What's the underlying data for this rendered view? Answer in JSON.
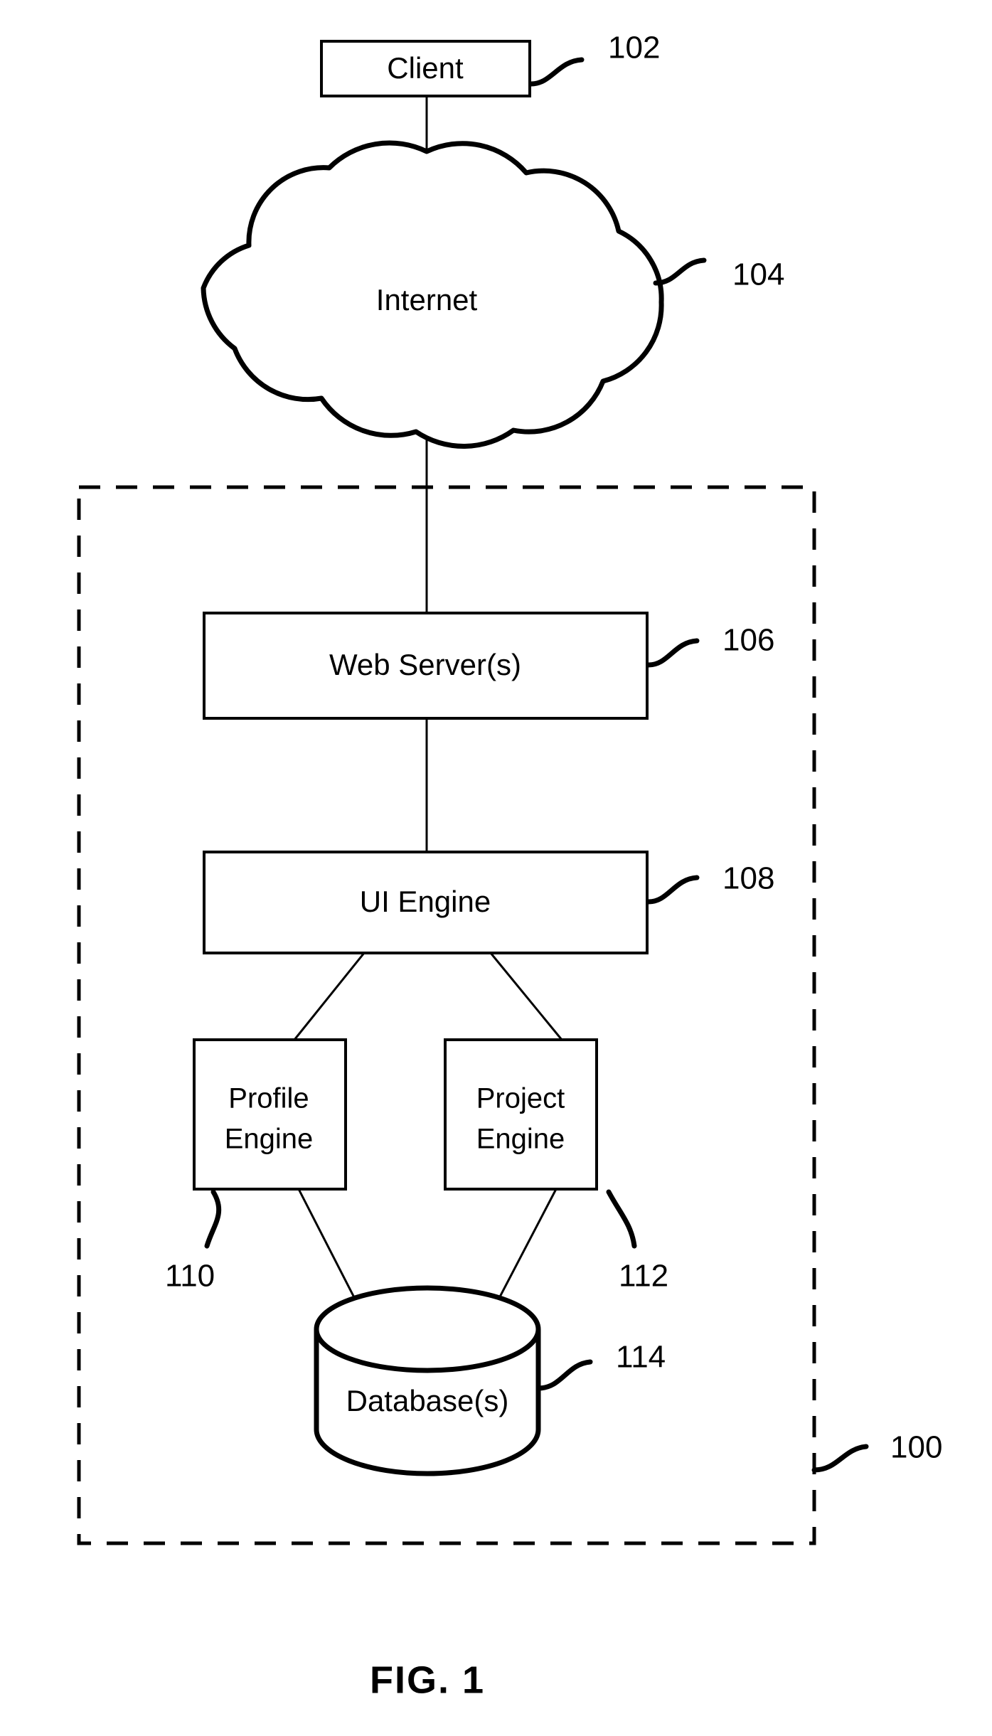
{
  "figure": {
    "caption": "FIG. 1",
    "system_ref": "100"
  },
  "nodes": {
    "client": {
      "label": "Client",
      "ref": "102"
    },
    "internet": {
      "label": "Internet",
      "ref": "104"
    },
    "web_server": {
      "label": "Web Server(s)",
      "ref": "106"
    },
    "ui_engine": {
      "label": "UI Engine",
      "ref": "108"
    },
    "profile_engine": {
      "label_line1": "Profile",
      "label_line2": "Engine",
      "ref": "110"
    },
    "project_engine": {
      "label_line1": "Project",
      "label_line2": "Engine",
      "ref": "112"
    },
    "database": {
      "label": "Database(s)",
      "ref": "114"
    }
  },
  "colors": {
    "stroke": "#000000",
    "fill": "#ffffff"
  }
}
